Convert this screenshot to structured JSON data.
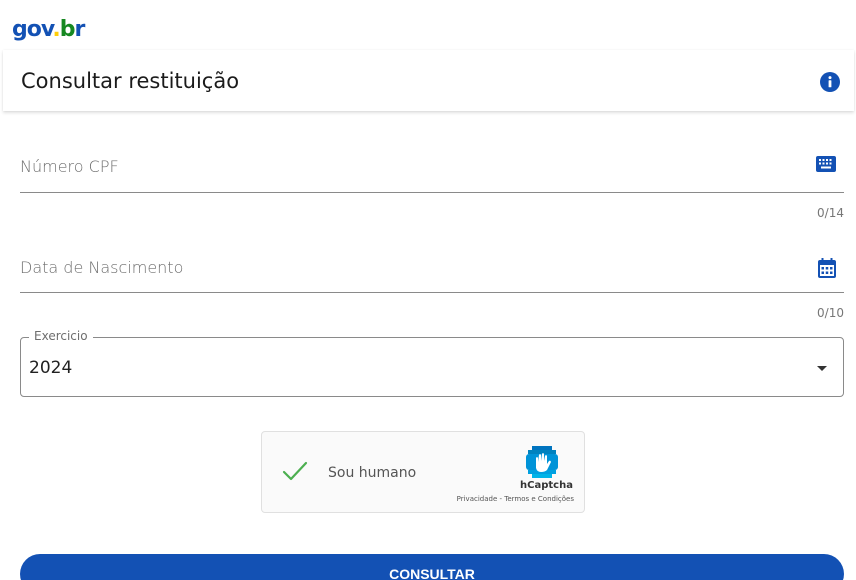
{
  "logo": {
    "text": "gov.br",
    "colors": {
      "blue": "#1351b4",
      "yellow": "#ffcd07",
      "green": "#168821"
    }
  },
  "header": {
    "title": "Consultar restituição",
    "info_icon": "info-icon"
  },
  "form": {
    "cpf": {
      "label": "Número CPF",
      "counter": "0/14",
      "icon": "keyboard-icon"
    },
    "birthdate": {
      "label": "Data de Nascimento",
      "counter": "0/10",
      "icon": "calendar-icon"
    },
    "exercicio": {
      "label": "Exercicio",
      "value": "2024",
      "icon": "dropdown-arrow-icon"
    }
  },
  "captcha": {
    "label": "Sou humano",
    "brand": "hCaptcha",
    "privacy": "Privacidade",
    "separator": " - ",
    "terms": "Termos e Condições"
  },
  "actions": {
    "submit_label": "CONSULTAR"
  },
  "colors": {
    "primary": "#1351b4",
    "check_green": "#4caf50",
    "line": "#8a8a8a"
  }
}
